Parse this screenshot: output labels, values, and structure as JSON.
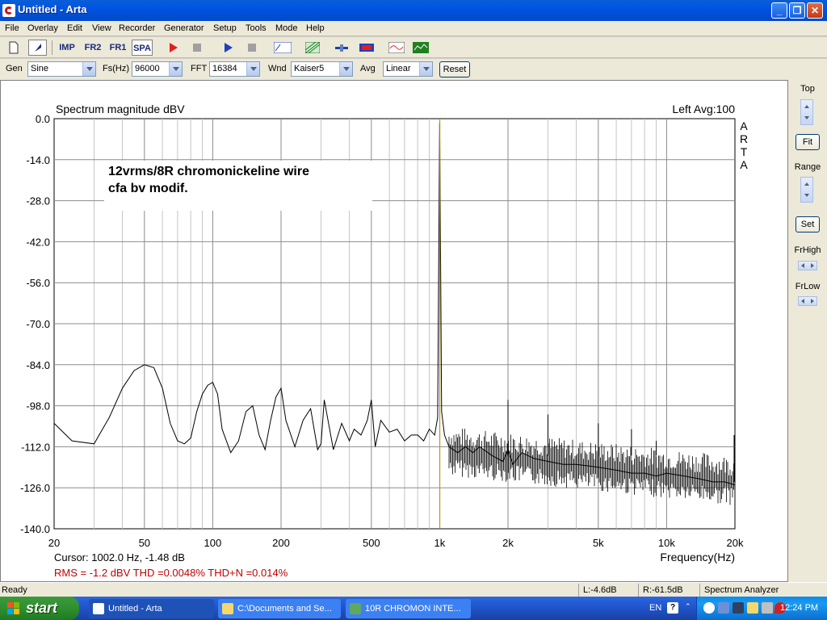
{
  "window": {
    "title": "Untitled - Arta"
  },
  "menu": [
    "File",
    "Overlay",
    "Edit",
    "View",
    "Recorder",
    "Generator",
    "Setup",
    "Tools",
    "Mode",
    "Help"
  ],
  "toolbar": {
    "imp": "IMP",
    "fr2": "FR2",
    "fr1": "FR1",
    "spa": "SPA"
  },
  "settings": {
    "gen_label": "Gen",
    "gen_value": "Sine",
    "fs_label": "Fs(Hz)",
    "fs_value": "96000",
    "fft_label": "FFT",
    "fft_value": "16384",
    "wnd_label": "Wnd",
    "wnd_value": "Kaiser5",
    "avg_label": "Avg",
    "avg_value": "Linear",
    "reset_label": "Reset"
  },
  "right_panel": {
    "top": "Top",
    "fit": "Fit",
    "range": "Range",
    "set": "Set",
    "frhigh": "FrHigh",
    "frlow": "FrLow"
  },
  "chart_data": {
    "type": "line",
    "title": "Spectrum magnitude dBV",
    "top_right": "Left  Avg:100",
    "watermark": [
      "A",
      "R",
      "T",
      "A"
    ],
    "annotation": [
      "12vrms/8R chromonickeline wire",
      "cfa bv modif."
    ],
    "xlabel": "Frequency(Hz)",
    "xscale": "log",
    "xlim": [
      20,
      20000
    ],
    "ylim": [
      -140,
      0
    ],
    "x_ticks": [
      {
        "v": 20,
        "label": "20"
      },
      {
        "v": 50,
        "label": "50"
      },
      {
        "v": 100,
        "label": "100"
      },
      {
        "v": 200,
        "label": "200"
      },
      {
        "v": 500,
        "label": "500"
      },
      {
        "v": 1000,
        "label": "1k"
      },
      {
        "v": 2000,
        "label": "2k"
      },
      {
        "v": 5000,
        "label": "5k"
      },
      {
        "v": 10000,
        "label": "10k"
      },
      {
        "v": 20000,
        "label": "20k"
      }
    ],
    "y_ticks": [
      {
        "v": 0,
        "label": "0.0"
      },
      {
        "v": -14,
        "label": "-14.0"
      },
      {
        "v": -28,
        "label": "-28.0"
      },
      {
        "v": -42,
        "label": "-42.0"
      },
      {
        "v": -56,
        "label": "-56.0"
      },
      {
        "v": -70,
        "label": "-70.0"
      },
      {
        "v": -84,
        "label": "-84.0"
      },
      {
        "v": -98,
        "label": "-98.0"
      },
      {
        "v": -112,
        "label": "-112.0"
      },
      {
        "v": -126,
        "label": "-126.0"
      },
      {
        "v": -140,
        "label": "-140.0"
      }
    ],
    "cursor_freq": 1002,
    "cursor_text": "Cursor:  1002.0 Hz, -1.48 dB",
    "results_text": "RMS =   -1.2 dBV   THD =0.0048%   THD+N =0.014%",
    "series": [
      {
        "color": "#000000",
        "x": [
          20,
          24,
          30,
          35,
          40,
          45,
          50,
          55,
          60,
          65,
          70,
          75,
          80,
          85,
          90,
          95,
          100,
          105,
          110,
          120,
          130,
          140,
          150,
          160,
          170,
          180,
          190,
          200,
          210,
          230,
          250,
          270,
          290,
          300,
          310,
          340,
          370,
          400,
          420,
          450,
          480,
          500,
          520,
          550,
          600,
          650,
          700,
          750,
          800,
          850,
          900,
          950,
          980,
          1000,
          1020,
          1050,
          1100,
          1200,
          1300,
          1400,
          1500,
          1700,
          1900,
          2000,
          2100,
          2300,
          2600,
          3000,
          3500,
          4000,
          5000,
          6000,
          7000,
          8000,
          9000,
          10000,
          12000,
          14000,
          16000,
          18000,
          20000
        ],
        "y": [
          -104,
          -110,
          -111,
          -102,
          -92,
          -86,
          -84,
          -85,
          -92,
          -104,
          -110,
          -111,
          -109,
          -100,
          -94,
          -91,
          -90,
          -94,
          -106,
          -114,
          -110,
          -100,
          -98,
          -108,
          -113,
          -103,
          -95,
          -92,
          -103,
          -112,
          -103,
          -99,
          -113,
          -111,
          -96,
          -113,
          -104,
          -110,
          -106,
          -108,
          -103,
          -96,
          -112,
          -103,
          -107,
          -106,
          -110,
          -108,
          -108,
          -110,
          -106,
          -108,
          -102,
          -1.5,
          -100,
          -108,
          -112,
          -114,
          -112,
          -114,
          -112,
          -115,
          -117,
          -113,
          -118,
          -114,
          -116,
          -117,
          -118,
          -118,
          -119,
          -120,
          -121,
          -121,
          -122,
          -121,
          -122,
          -123,
          -124,
          -124,
          -125
        ]
      }
    ],
    "harmonics": [
      {
        "f": 3000,
        "y": -101
      },
      {
        "f": 5000,
        "y": -104
      },
      {
        "f": 7000,
        "y": -106
      },
      {
        "f": 9000,
        "y": -110
      },
      {
        "f": 2000,
        "y": -96
      }
    ]
  },
  "status": {
    "ready": "Ready",
    "l": "L:-4.6dB",
    "r": "R:-61.5dB",
    "mode": "Spectrum Analyzer"
  },
  "taskbar": {
    "start": "start",
    "tasks": [
      "Untitled - Arta",
      "C:\\Documents and Se...",
      "10R CHROMON INTE..."
    ],
    "lang": "EN",
    "clock": "12:24 PM"
  }
}
